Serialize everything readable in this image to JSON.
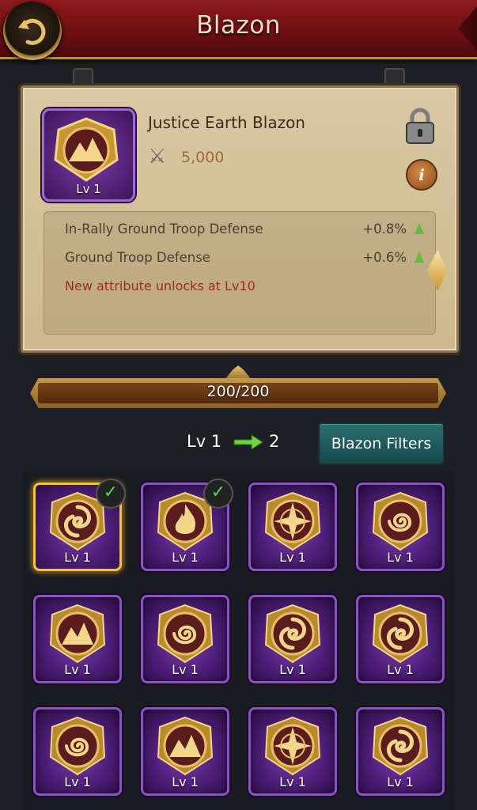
{
  "header": {
    "title": "Blazon"
  },
  "detail": {
    "name": "Justice Earth Blazon",
    "level": "Lv 1",
    "power": "5,000",
    "attributes": [
      {
        "label": "In-Rally Ground Troop Defense",
        "value": "+0.8%"
      },
      {
        "label": "Ground Troop Defense",
        "value": "+0.6%"
      }
    ],
    "unlock_note": "New attribute unlocks at Lv10"
  },
  "progress": {
    "text": "200/200",
    "fraction": 1.0
  },
  "upgrade": {
    "from": "Lv 1",
    "to": "2"
  },
  "filters_button": "Blazon Filters",
  "grid": [
    {
      "level": "Lv 1",
      "emblem": "swirl",
      "checked": true,
      "selected": true
    },
    {
      "level": "Lv 1",
      "emblem": "flame",
      "checked": true,
      "selected": false
    },
    {
      "level": "Lv 1",
      "emblem": "compass",
      "checked": false,
      "selected": false
    },
    {
      "level": "Lv 1",
      "emblem": "spiral",
      "checked": false,
      "selected": false
    },
    {
      "level": "Lv 1",
      "emblem": "mountain",
      "checked": false,
      "selected": false
    },
    {
      "level": "Lv 1",
      "emblem": "spiral",
      "checked": false,
      "selected": false
    },
    {
      "level": "Lv 1",
      "emblem": "swirl",
      "checked": false,
      "selected": false
    },
    {
      "level": "Lv 1",
      "emblem": "swirl",
      "checked": false,
      "selected": false
    },
    {
      "level": "Lv 1",
      "emblem": "spiral",
      "checked": false,
      "selected": false
    },
    {
      "level": "Lv 1",
      "emblem": "mountain",
      "checked": false,
      "selected": false
    },
    {
      "level": "Lv 1",
      "emblem": "compass",
      "checked": false,
      "selected": false
    },
    {
      "level": "Lv 1",
      "emblem": "swirl",
      "checked": false,
      "selected": false
    }
  ],
  "colors": {
    "header": "#7a1416",
    "panel": "#d3c19b",
    "tile": "#5a2488",
    "accent_gold": "#d8ac4e",
    "button": "#1f5c5e"
  }
}
